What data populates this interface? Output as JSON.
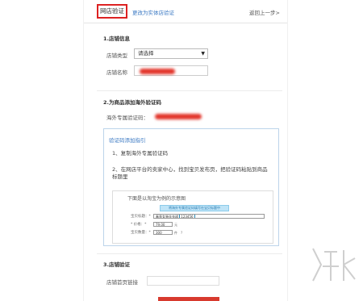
{
  "tabs": {
    "active": "网店验证",
    "alt": "更改为实体店验证",
    "prev": "返回上一步>"
  },
  "section1": {
    "title": "1.店铺信息",
    "type_label": "店铺类型",
    "type_value": "请选择",
    "name_label": "店铺名称"
  },
  "section2": {
    "title": "2.为商品添加海外验证码",
    "code_label": "海外专属验证码："
  },
  "help": {
    "title": "验证码添加指引",
    "step1": "1、复制海外专属验证码",
    "step2": "2、在网店平台的卖家中心，找到宝贝发布页，把验证码粘贴到商品标题里",
    "sample_caption": "下面是以淘宝为例的示意图",
    "sample_banner": "将海外专属验证码填写在宝贝标题中",
    "sample_title_label": "宝贝标题：*",
    "sample_title_value": "春季女装连衣裙",
    "sample_code": "123456",
    "sample_price_label": "* 价格：*",
    "sample_price_value": "79.00",
    "sample_price_unit": "元",
    "sample_qty_label": "宝贝数量：*",
    "sample_qty_value": "300",
    "sample_qty_unit": "件",
    "sample_qty_note": "?"
  },
  "section3": {
    "title": "3.店铺验证",
    "addr_label": "店铺首页链接"
  },
  "colors": {
    "accent_red": "#d83a2e",
    "link_blue": "#3a78c3",
    "help_border": "#bcd4ea"
  }
}
